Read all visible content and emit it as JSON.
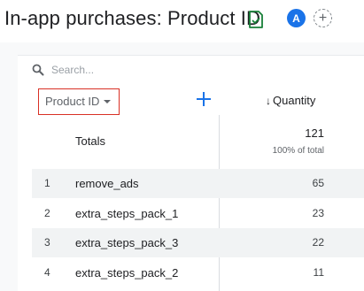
{
  "header": {
    "title": "In-app purchases: Product ID",
    "avatar_letter": "A",
    "add_comparison_symbol": "+"
  },
  "search": {
    "placeholder": "Search..."
  },
  "table": {
    "dimension_label": "Product ID",
    "metric_label": "Quantity",
    "sort_indicator": "↓",
    "totals": {
      "label": "Totals",
      "value": "121",
      "percent_label": "100% of total"
    },
    "rows": [
      {
        "index": "1",
        "name": "remove_ads",
        "value": "65"
      },
      {
        "index": "2",
        "name": "extra_steps_pack_1",
        "value": "23"
      },
      {
        "index": "3",
        "name": "extra_steps_pack_3",
        "value": "22"
      },
      {
        "index": "4",
        "name": "extra_steps_pack_2",
        "value": "11"
      }
    ]
  },
  "icons": {
    "status": "verified-report-icon",
    "search": "search-icon",
    "add_dimension": "plus-icon",
    "dropdown": "caret-down-icon"
  },
  "colors": {
    "accent": "#1a73e8",
    "status_green": "#188038",
    "highlight_border": "#d93025",
    "row_shade": "#f1f3f4"
  }
}
